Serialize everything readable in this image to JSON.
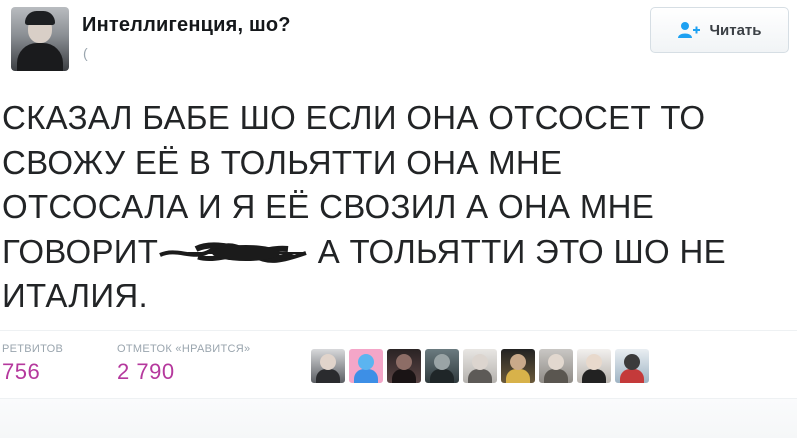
{
  "author": {
    "name": "Интеллигенция, шо?",
    "handle": "("
  },
  "follow_button": {
    "label": "Читать",
    "icon": "add-user-icon",
    "accent": "#1da1f2"
  },
  "tweet": {
    "lines": [
      "СКАЗАЛ БАБЕ ШО ЕСЛИ ОНА ОТСОСЕТ ТО",
      "СВОЖУ ЕЁ В ТОЛЬЯТТИ ОНА МНЕ",
      "ОТСОСАЛА И Я ЕЁ СВОЗИЛ А ОНА МНЕ"
    ],
    "line4_before": "ГОВОРИТ",
    "line4_after": " А ТОЛЬЯТТИ ЭТО ШО НЕ",
    "line5": "ИТАЛИЯ."
  },
  "stats": {
    "retweets_label": "РЕТВИТОВ",
    "retweets_value": "756",
    "likes_label": "ОТМЕТОК «НРАВИТСЯ»",
    "likes_value": "2 790",
    "value_color": "#b5389d"
  },
  "likers": [
    {
      "icon": "user-avatar-icon"
    },
    {
      "icon": "user-avatar-icon"
    },
    {
      "icon": "user-avatar-icon"
    },
    {
      "icon": "user-avatar-icon"
    },
    {
      "icon": "user-avatar-icon"
    },
    {
      "icon": "user-avatar-icon"
    },
    {
      "icon": "user-avatar-icon"
    },
    {
      "icon": "user-avatar-icon"
    },
    {
      "icon": "user-avatar-icon"
    }
  ]
}
